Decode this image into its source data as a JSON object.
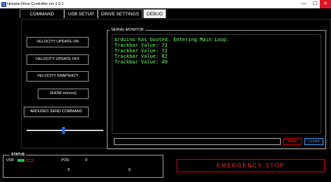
{
  "window": {
    "title": "Hioople Drive Controller ver 1.0.1",
    "minimize": "—",
    "maximize": "☐",
    "close": "✕"
  },
  "tabs": [
    {
      "label": "COMMAND CENTRE",
      "active": false
    },
    {
      "label": "USB SETUP",
      "active": false
    },
    {
      "label": "DRIVE SETTINGS",
      "active": false
    },
    {
      "label": "DEBUG",
      "active": true
    }
  ],
  "debug": {
    "buttons": {
      "velocity_update_on": "VELOCITY UPDATE ON",
      "velocity_update_off": "VELOCITY UPDATE OFF",
      "velocity_snapshot": "VELOCITY SNAPSHOT",
      "show_micros": "SHOW micros()",
      "arduino_send_command": "ARDUINO: SEND COMMAND"
    },
    "slider_level": 0.48
  },
  "serial_monitor": {
    "title": "SERIAL MONITOR",
    "lines": [
      "Arduino has booted. Entering Main Loop.",
      "Trackbar Value: 72",
      "Trackbar Value: 72",
      "Trackbar Value: 62",
      "Trackbar Value: 49"
    ],
    "input_value": "",
    "send_label": "SEND",
    "clear_label": "CLEAR"
  },
  "status": {
    "title": "STATUS",
    "usb_label": "USB:",
    "pos_label": "POS:",
    "pos_value_1": "0",
    "pos_value_2": "0",
    "pos_value_3": "0",
    "usb_connected_color": "#21c23a",
    "usb_disconnected_color": "#cc0000"
  },
  "emergency_stop": {
    "label": "EMERGENCY STOP",
    "color": "#ff2020"
  }
}
